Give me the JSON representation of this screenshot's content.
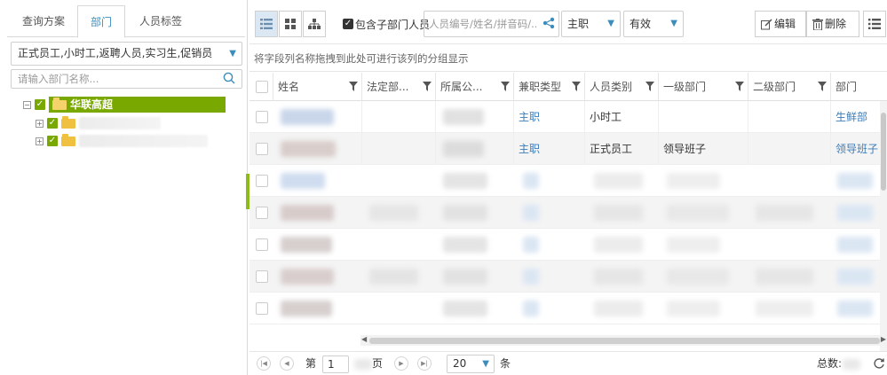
{
  "left": {
    "tabs": [
      {
        "label": "查询方案",
        "active": false
      },
      {
        "label": "部门",
        "active": true
      },
      {
        "label": "人员标签",
        "active": false
      }
    ],
    "type_select": "正式员工,小时工,返聘人员,实习生,促销员",
    "search_placeholder": "请输入部门名称...",
    "tree_root": "华联高超"
  },
  "toolbar": {
    "include_sub_label": "包含子部门人员",
    "include_sub_checked": true,
    "person_search_placeholder": "人员编号/姓名/拼音码/...",
    "post_type": "主职",
    "status": "有效",
    "edit_label": "编辑",
    "delete_label": "删除"
  },
  "group_hint": "将字段列名称拖拽到此处可进行该列的分组显示",
  "grid": {
    "columns": [
      "姓名",
      "法定部...",
      "所属公...",
      "兼职类型",
      "人员类别",
      "一级部门",
      "二级部门",
      "部门"
    ],
    "rows": [
      {
        "part_type": "主职",
        "category": "小时工",
        "level1": "",
        "dept": "生鲜部"
      },
      {
        "part_type": "主职",
        "category": "正式员工",
        "level1": "领导班子",
        "dept": "领导班子"
      }
    ]
  },
  "pager": {
    "page_prefix": "第",
    "page_value": "1",
    "page_suffix": "页",
    "page_size": "20",
    "page_size_unit": "条",
    "total_label": "总数:"
  },
  "colors": {
    "accent_green": "#79a800",
    "link_blue": "#3c7cb8",
    "tab_active": "#3c8dbc"
  }
}
